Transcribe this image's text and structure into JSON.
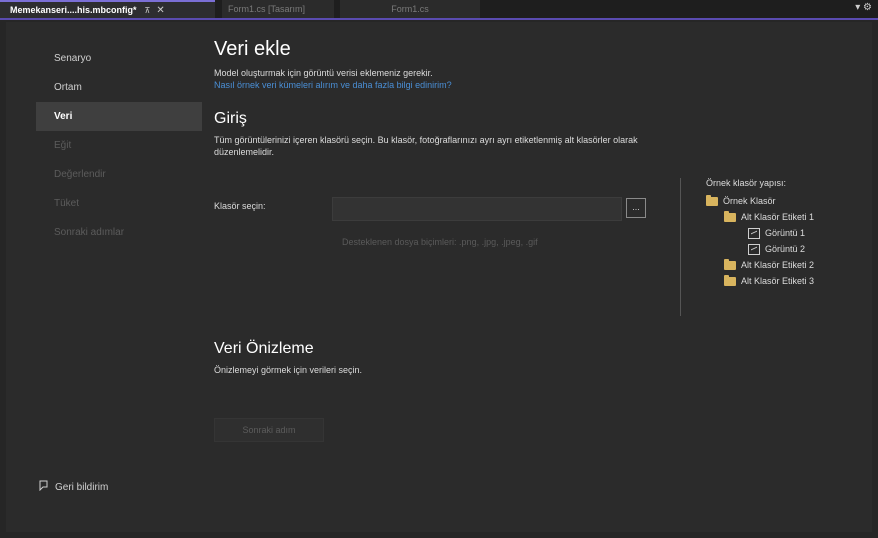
{
  "tabs": {
    "active": {
      "title": "Memekanseri....his.mbconfig*",
      "pin": "⊼",
      "close": "✕"
    },
    "inactive": [
      "Form1.cs [Tasarım]",
      "Form1.cs"
    ],
    "right": "▾ ⚙"
  },
  "sidebar": {
    "items": [
      {
        "label": "Senaryo",
        "state": "normal"
      },
      {
        "label": "Ortam",
        "state": "normal"
      },
      {
        "label": "Veri",
        "state": "active"
      },
      {
        "label": "Eğit",
        "state": "disabled"
      },
      {
        "label": "Değerlendir",
        "state": "disabled"
      },
      {
        "label": "Tüket",
        "state": "disabled"
      },
      {
        "label": "Sonraki adımlar",
        "state": "disabled"
      }
    ],
    "feedback": {
      "icon": "feedback-icon",
      "label": "Geri bildirim"
    }
  },
  "main": {
    "title": "Veri ekle",
    "description": "Model oluşturmak için görüntü verisi eklemeniz gerekir.",
    "link": "Nasıl örnek veri kümeleri alırım ve daha fazla bilgi edinirim?",
    "input_section": {
      "title": "Giriş",
      "description": "Tüm görüntülerinizi içeren klasörü seçin. Bu klasör, fotoğraflarınızı ayrı ayrı etiketlenmiş alt klasörler olarak düzenlemelidir.",
      "folder_label": "Klasör seçin:",
      "folder_value": "",
      "browse_label": "...",
      "hint": "Desteklenen dosya biçimleri: .png, .jpg, .jpeg, .gif"
    },
    "preview_section": {
      "title": "Veri Önizleme",
      "description": "Önizlemeyi görmek için verileri seçin."
    },
    "next_button": "Sonraki adım"
  },
  "sample_tree": {
    "title": "Örnek klasör yapısı:",
    "nodes": [
      {
        "label": "Örnek Klasör",
        "icon": "folder-icon",
        "level": 0
      },
      {
        "label": "Alt Klasör Etiketi 1",
        "icon": "folder-icon",
        "level": 1
      },
      {
        "label": "Görüntü 1",
        "icon": "image-icon",
        "level": 2
      },
      {
        "label": "Görüntü 2",
        "icon": "image-icon",
        "level": 2
      },
      {
        "label": "Alt Klasör Etiketi 2",
        "icon": "folder-icon",
        "level": 1
      },
      {
        "label": "Alt Klasör Etiketi 3",
        "icon": "folder-icon",
        "level": 1
      }
    ]
  },
  "colors": {
    "background": "#262626",
    "accent": "#7b6fd6",
    "link": "#4a8fd6",
    "folder": "#d8b45e"
  }
}
